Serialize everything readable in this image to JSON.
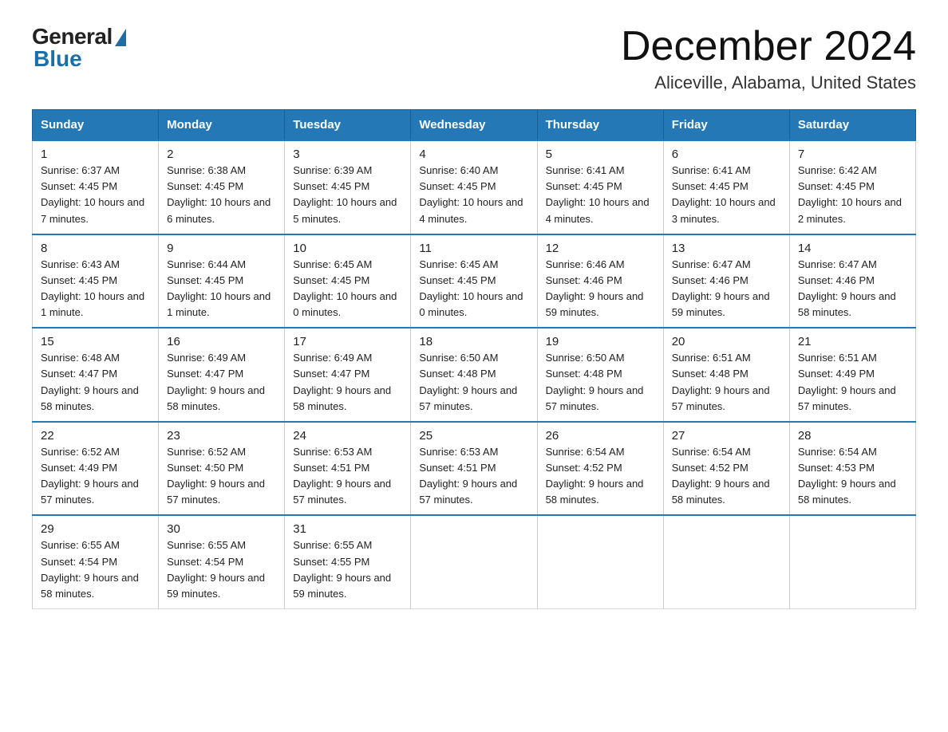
{
  "logo": {
    "text_general": "General",
    "text_blue": "Blue"
  },
  "header": {
    "month_year": "December 2024",
    "location": "Aliceville, Alabama, United States"
  },
  "weekdays": [
    "Sunday",
    "Monday",
    "Tuesday",
    "Wednesday",
    "Thursday",
    "Friday",
    "Saturday"
  ],
  "weeks": [
    [
      {
        "day": "1",
        "sunrise": "6:37 AM",
        "sunset": "4:45 PM",
        "daylight": "10 hours and 7 minutes."
      },
      {
        "day": "2",
        "sunrise": "6:38 AM",
        "sunset": "4:45 PM",
        "daylight": "10 hours and 6 minutes."
      },
      {
        "day": "3",
        "sunrise": "6:39 AM",
        "sunset": "4:45 PM",
        "daylight": "10 hours and 5 minutes."
      },
      {
        "day": "4",
        "sunrise": "6:40 AM",
        "sunset": "4:45 PM",
        "daylight": "10 hours and 4 minutes."
      },
      {
        "day": "5",
        "sunrise": "6:41 AM",
        "sunset": "4:45 PM",
        "daylight": "10 hours and 4 minutes."
      },
      {
        "day": "6",
        "sunrise": "6:41 AM",
        "sunset": "4:45 PM",
        "daylight": "10 hours and 3 minutes."
      },
      {
        "day": "7",
        "sunrise": "6:42 AM",
        "sunset": "4:45 PM",
        "daylight": "10 hours and 2 minutes."
      }
    ],
    [
      {
        "day": "8",
        "sunrise": "6:43 AM",
        "sunset": "4:45 PM",
        "daylight": "10 hours and 1 minute."
      },
      {
        "day": "9",
        "sunrise": "6:44 AM",
        "sunset": "4:45 PM",
        "daylight": "10 hours and 1 minute."
      },
      {
        "day": "10",
        "sunrise": "6:45 AM",
        "sunset": "4:45 PM",
        "daylight": "10 hours and 0 minutes."
      },
      {
        "day": "11",
        "sunrise": "6:45 AM",
        "sunset": "4:45 PM",
        "daylight": "10 hours and 0 minutes."
      },
      {
        "day": "12",
        "sunrise": "6:46 AM",
        "sunset": "4:46 PM",
        "daylight": "9 hours and 59 minutes."
      },
      {
        "day": "13",
        "sunrise": "6:47 AM",
        "sunset": "4:46 PM",
        "daylight": "9 hours and 59 minutes."
      },
      {
        "day": "14",
        "sunrise": "6:47 AM",
        "sunset": "4:46 PM",
        "daylight": "9 hours and 58 minutes."
      }
    ],
    [
      {
        "day": "15",
        "sunrise": "6:48 AM",
        "sunset": "4:47 PM",
        "daylight": "9 hours and 58 minutes."
      },
      {
        "day": "16",
        "sunrise": "6:49 AM",
        "sunset": "4:47 PM",
        "daylight": "9 hours and 58 minutes."
      },
      {
        "day": "17",
        "sunrise": "6:49 AM",
        "sunset": "4:47 PM",
        "daylight": "9 hours and 58 minutes."
      },
      {
        "day": "18",
        "sunrise": "6:50 AM",
        "sunset": "4:48 PM",
        "daylight": "9 hours and 57 minutes."
      },
      {
        "day": "19",
        "sunrise": "6:50 AM",
        "sunset": "4:48 PM",
        "daylight": "9 hours and 57 minutes."
      },
      {
        "day": "20",
        "sunrise": "6:51 AM",
        "sunset": "4:48 PM",
        "daylight": "9 hours and 57 minutes."
      },
      {
        "day": "21",
        "sunrise": "6:51 AM",
        "sunset": "4:49 PM",
        "daylight": "9 hours and 57 minutes."
      }
    ],
    [
      {
        "day": "22",
        "sunrise": "6:52 AM",
        "sunset": "4:49 PM",
        "daylight": "9 hours and 57 minutes."
      },
      {
        "day": "23",
        "sunrise": "6:52 AM",
        "sunset": "4:50 PM",
        "daylight": "9 hours and 57 minutes."
      },
      {
        "day": "24",
        "sunrise": "6:53 AM",
        "sunset": "4:51 PM",
        "daylight": "9 hours and 57 minutes."
      },
      {
        "day": "25",
        "sunrise": "6:53 AM",
        "sunset": "4:51 PM",
        "daylight": "9 hours and 57 minutes."
      },
      {
        "day": "26",
        "sunrise": "6:54 AM",
        "sunset": "4:52 PM",
        "daylight": "9 hours and 58 minutes."
      },
      {
        "day": "27",
        "sunrise": "6:54 AM",
        "sunset": "4:52 PM",
        "daylight": "9 hours and 58 minutes."
      },
      {
        "day": "28",
        "sunrise": "6:54 AM",
        "sunset": "4:53 PM",
        "daylight": "9 hours and 58 minutes."
      }
    ],
    [
      {
        "day": "29",
        "sunrise": "6:55 AM",
        "sunset": "4:54 PM",
        "daylight": "9 hours and 58 minutes."
      },
      {
        "day": "30",
        "sunrise": "6:55 AM",
        "sunset": "4:54 PM",
        "daylight": "9 hours and 59 minutes."
      },
      {
        "day": "31",
        "sunrise": "6:55 AM",
        "sunset": "4:55 PM",
        "daylight": "9 hours and 59 minutes."
      },
      null,
      null,
      null,
      null
    ]
  ]
}
